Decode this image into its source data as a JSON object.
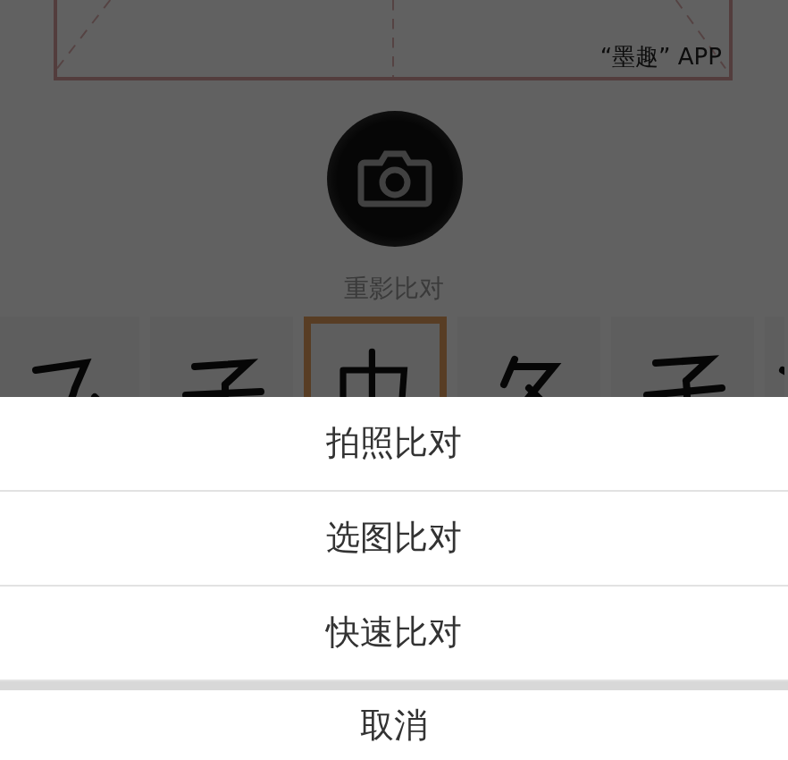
{
  "watermark_caption": "“墨趣” APP",
  "capture_label": "重影比对",
  "thumbnails": [
    {
      "kind": "picture",
      "selected": false
    },
    {
      "kind": "picture",
      "selected": false
    },
    {
      "kind": "picture",
      "selected": true
    },
    {
      "kind": "picture",
      "selected": false
    },
    {
      "kind": "picture",
      "selected": false
    },
    {
      "kind": "picture",
      "selected": false
    }
  ],
  "action_sheet": {
    "options": [
      "拍照比对",
      "选图比对",
      "快速比对"
    ],
    "cancel": "取消"
  }
}
